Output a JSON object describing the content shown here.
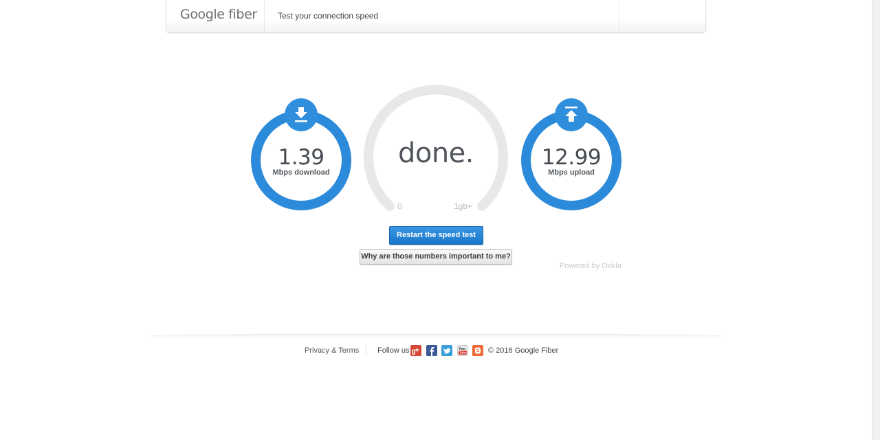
{
  "header": {
    "brand": "Google fiber",
    "tagline": "Test your connection speed"
  },
  "download": {
    "value": "1.39",
    "label": "Mbps download",
    "icon": "download-arrow-icon"
  },
  "upload": {
    "value": "12.99",
    "label": "Mbps upload",
    "icon": "upload-arrow-icon"
  },
  "gauge": {
    "status": "done.",
    "min_label": "0",
    "max_label": "1gb+"
  },
  "actions": {
    "restart_label": "Restart the speed test",
    "why_label": "Why are those numbers important to me?"
  },
  "powered_by": "Powered by Ookla",
  "footer": {
    "privacy_link": "Privacy & Terms",
    "follow_label": "Follow us",
    "social": [
      "google-plus-icon",
      "facebook-icon",
      "twitter-icon",
      "youtube-icon",
      "blogger-icon"
    ],
    "copyright": "© 2016 Google Fiber"
  },
  "colors": {
    "accent_blue": "#2b8ad9",
    "gauge_track": "#e7e8e9",
    "button_blue": "#1a76c8"
  }
}
